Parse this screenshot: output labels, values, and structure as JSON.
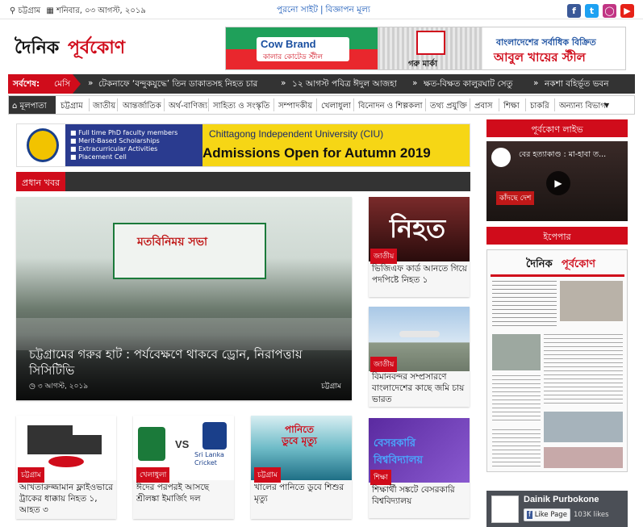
{
  "topbar": {
    "location": "চট্টগ্রাম",
    "date": "শনিবার, ০৩ আগস্ট, ২০১৯",
    "old_site": "পুরনো সাইট",
    "ad_rates": "বিজ্ঞাপন মূল্য",
    "social": [
      "facebook-icon",
      "twitter-icon",
      "instagram-icon",
      "youtube-icon"
    ]
  },
  "logo": {
    "text1": "দৈনিক",
    "text2": "পূর্বকোণ"
  },
  "top_ad": {
    "brand": "Cow Brand",
    "brand_sub": "কালার কোটেড স্টীল",
    "mark": "গরু মার্কা",
    "headline1": "বাংলাদেশের সর্বাধিক বিক্রিত",
    "headline2": "আবুল খায়ের স্টীল"
  },
  "ticker": {
    "label": "সর্বশেষ:",
    "items": [
      "মেসি",
      "টেকনাফে ‘বন্দুকযুদ্ধে’ তিন ডাকাতসহ নিহত চার",
      "১২ আগস্ট পবিত্র ঈদুল আজহা",
      "ক্ষত-বিক্ষত কালুরঘাট সেতু",
      "নকশা বহির্ভূত ভবন"
    ]
  },
  "nav": {
    "home": "মূলপাতা",
    "items": [
      "চট্টগ্রাম",
      "জাতীয়",
      "আন্তর্জাতিক",
      "অর্থ-বাণিজ্য",
      "সাহিত্য ও সংস্কৃতি",
      "সম্পাদকীয়",
      "খেলাধুলা",
      "বিনোদন ও শিল্পকলা",
      "তথ্য প্রযুক্তি",
      "প্রবাস",
      "শিক্ষা",
      "চাকরি",
      "অন্যান্য বিভাগ"
    ]
  },
  "ciu_ad": {
    "bullets": [
      "Full time PhD faculty members",
      "Merit-Based Scholarships",
      "Extracurricular Activities",
      "Placement Cell"
    ],
    "title": "Chittagong Independent University (CIU)",
    "sub": "Admissions Open for Autumn 2019"
  },
  "main_section": {
    "label": "প্রধান খবর"
  },
  "lead": {
    "title": "চট্টগ্রামের গরুর হাট : পর্যবেক্ষণে থাকবে ড্রোন, নিরাপত্তায় সিসিটিভি",
    "date": "৩ আগস্ট, ২০১৯",
    "category": "চট্টগ্রাম",
    "banner": "মতবিনিময় সভা"
  },
  "side_cards": [
    {
      "category": "জাতীয়",
      "title": "ভিজিএফ কার্ড আনতে গিয়ে পদপিষ্টে নিহত ১",
      "image_text": "নিহত"
    },
    {
      "category": "জাতীয়",
      "title": "বিমানবন্দর সম্প্রসারণে বাংলাদেশের কাছে জমি চায় ভারত"
    },
    {
      "category": "শিক্ষা",
      "title": "শিক্ষার্থী সঙ্কটে বেসরকারি বিশ্ববিদ্যালয়",
      "image_text": "বেসরকারি বিশ্ববিদ্যালয়"
    }
  ],
  "bottom_cards": [
    {
      "category": "চট্টগ্রাম",
      "title": "আখতারুজ্জামান ফ্লাইওভারে ট্রাকের ধাক্কায় নিহত ১, আহত ৩"
    },
    {
      "category": "খেলাধুলা",
      "title": "ঈদের পরপরই আসছে শ্রীলঙ্কা ইমার্জিং দল",
      "vs": "VS",
      "team": "Sri Lanka Cricket"
    },
    {
      "category": "চট্টগ্রাম",
      "title": "খালের পানিতে ডুবে শিশুর মৃত্যু",
      "image_text": "পানিতে ডুবে মৃত্যু"
    }
  ],
  "sidebar": {
    "live_label": "পূর্বকোণ লাইভ",
    "video_title": "বের হত্যাকাণ্ড : মা-হাবা ত...",
    "video_caption": "কাঁদছে দেশ",
    "epaper_label": "ইপেপার",
    "epaper_logo1": "দৈনিক",
    "epaper_logo2": "পূর্বকোণ",
    "fb_name": "Dainik Purbokone",
    "fb_like": "Like Page",
    "fb_likes": "103K likes"
  },
  "colors": {
    "accent": "#d00c1b",
    "dark": "#333333"
  }
}
